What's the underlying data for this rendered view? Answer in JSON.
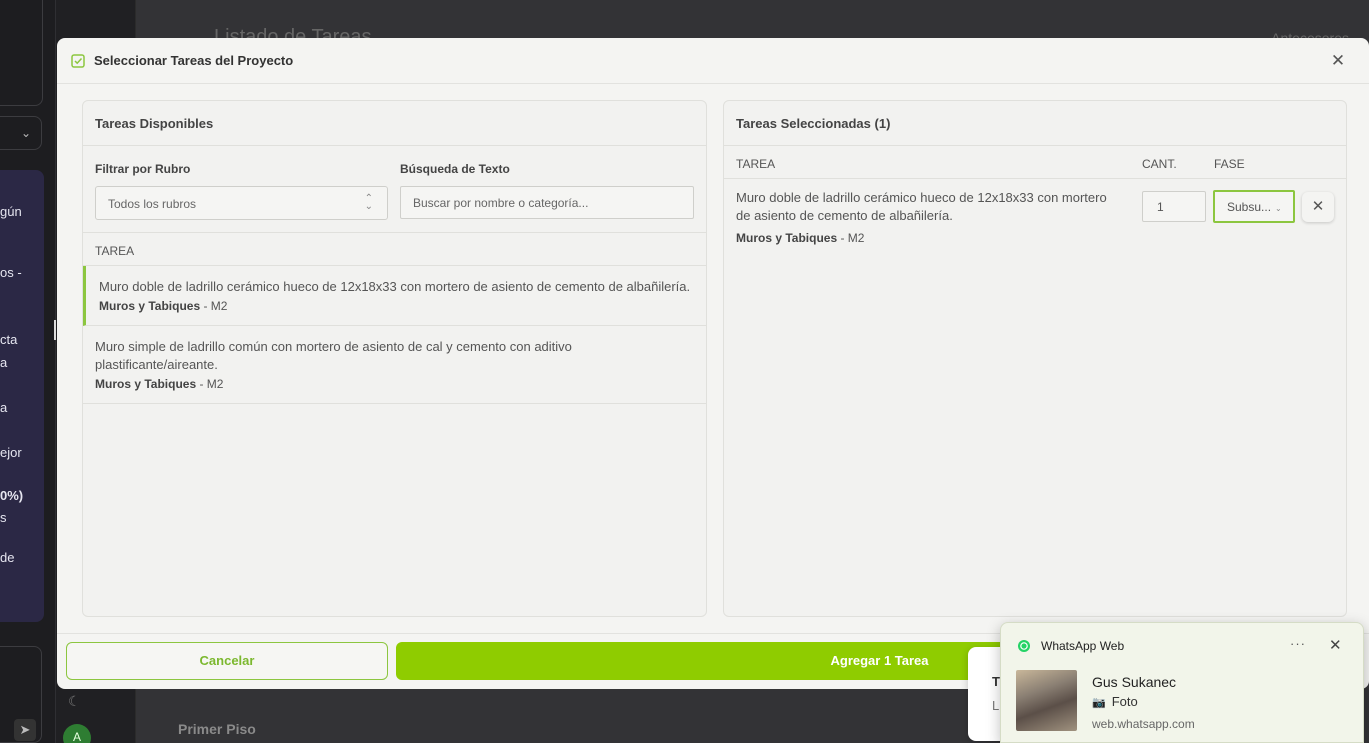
{
  "background": {
    "sidebar_partial_texts": [
      "gún",
      "os -",
      "cta",
      "a",
      "a",
      "ejor",
      "0%)",
      "s",
      "de"
    ],
    "page_title": "Listado de Tareas",
    "right_action": "Antecesores",
    "floor_label": "Primer Piso",
    "avatar_initial": "A"
  },
  "modal": {
    "title": "Seleccionar Tareas del Proyecto",
    "accent_color": "#8cc63f",
    "available": {
      "title": "Tareas Disponibles",
      "filter_label": "Filtrar por Rubro",
      "filter_value": "Todos los rubros",
      "search_label": "Búsqueda de Texto",
      "search_placeholder": "Buscar por nombre o categoría...",
      "column_task": "TAREA",
      "tasks": [
        {
          "name": "Muro doble de ladrillo cerámico hueco de 12x18x33 con mortero de asiento de cemento de albañilería.",
          "category": "Muros y Tabiques",
          "unit": " - M2",
          "selected": true
        },
        {
          "name": "Muro simple de ladrillo común con mortero de asiento de cal y cemento con aditivo plastificante/aireante.",
          "category": "Muros y Tabiques",
          "unit": " - M2",
          "selected": false
        }
      ]
    },
    "selected": {
      "title": "Tareas Seleccionadas (1)",
      "col_task": "TAREA",
      "col_qty": "CANT.",
      "col_phase": "FASE",
      "rows": [
        {
          "name": "Muro doble de ladrillo cerámico hueco de 12x18x33 con mortero de asiento de cemento de albañilería.",
          "category": "Muros y Tabiques",
          "unit": " - M2",
          "qty": "1",
          "phase": "Subsu..."
        }
      ]
    },
    "footer": {
      "cancel_label": "Cancelar",
      "add_label": "Agregar 1 Tarea"
    }
  },
  "toast": {
    "title": "T",
    "text": "L"
  },
  "notification": {
    "app": "WhatsApp Web",
    "sender": "Gus Sukanec",
    "message": "Foto",
    "domain": "web.whatsapp.com"
  }
}
